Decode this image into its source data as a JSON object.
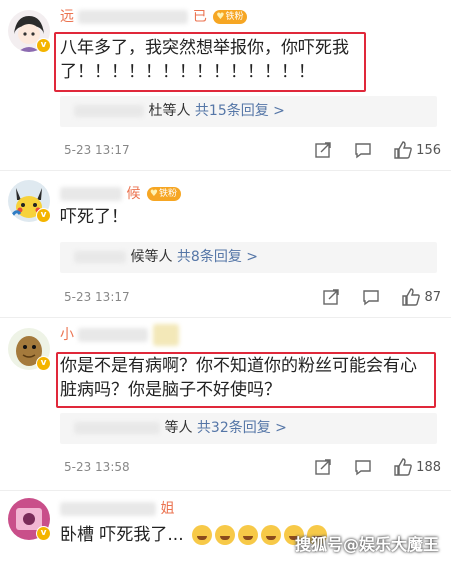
{
  "comments": [
    {
      "name_visible": "远",
      "name_visible_end": "已",
      "badge": "铁粉",
      "text": "八年多了，我突然想举报你，你吓死我了！！！！！！！！！！！！！！",
      "replies_prefix": "杜等人",
      "replies_count_text": "共15条回复 >",
      "timestamp": "5-23 13:17",
      "likes": "156"
    },
    {
      "name_visible": "候",
      "badge": "铁粉",
      "text": "吓死了！",
      "replies_prefix": "候等人",
      "replies_count_text": "共8条回复 >",
      "timestamp": "5-23 13:17",
      "likes": "87"
    },
    {
      "name_visible": "小",
      "badge": "",
      "text": "你是不是有病啊？你不知道你的粉丝可能会有心脏病吗？你是脑子不好使吗？",
      "replies_prefix": "等人",
      "replies_count_text": "共32条回复 >",
      "timestamp": "5-23 13:58",
      "likes": "188"
    },
    {
      "name_visible": "姐",
      "badge": "",
      "text": "卧槽  吓死我了...",
      "replies_prefix": "",
      "replies_count_text": "",
      "timestamp": "",
      "likes": ""
    }
  ],
  "watermark": "搜狐号@娱乐大魔王",
  "colors": {
    "highlight": "#e0283a",
    "username": "#eb7350",
    "fan_badge": "#f6a623",
    "link": "#5576a7"
  },
  "icons": [
    "share-icon",
    "comment-icon",
    "like-icon",
    "verified-badge-icon",
    "laugh-cry-emoji"
  ]
}
